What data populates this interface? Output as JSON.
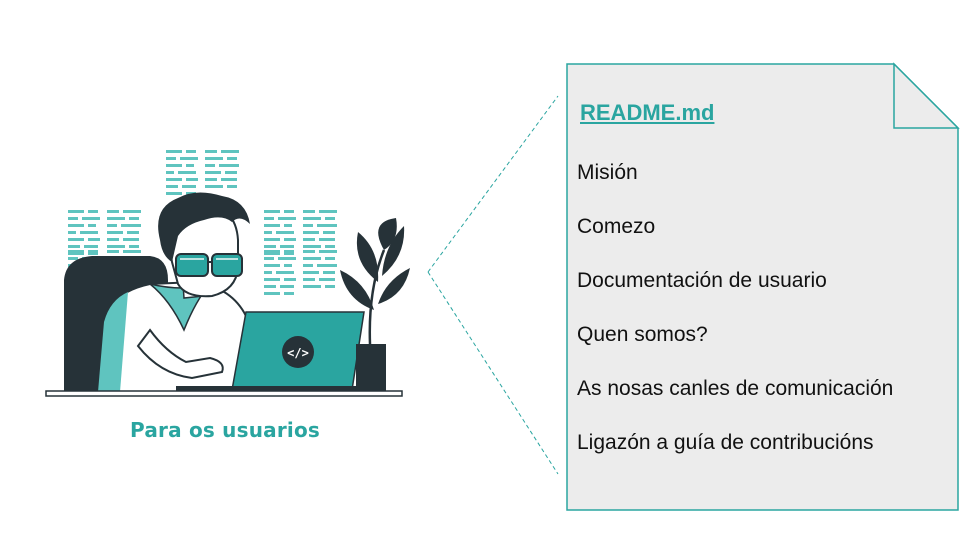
{
  "caption": "Para os usuarios",
  "readme": {
    "title": "README.md",
    "items": [
      "Misión",
      "Comezo",
      "Documentación de usuario",
      "Quen somos?",
      "As nosas canles de comunicación",
      "Ligazón a guía de contribucións"
    ]
  },
  "illustration": {
    "laptop_icon": "</>"
  },
  "colors": {
    "accent": "#2aa5a0",
    "dark": "#263238",
    "doc_fill": "#ececec",
    "doc_border": "#2aa5a0"
  }
}
